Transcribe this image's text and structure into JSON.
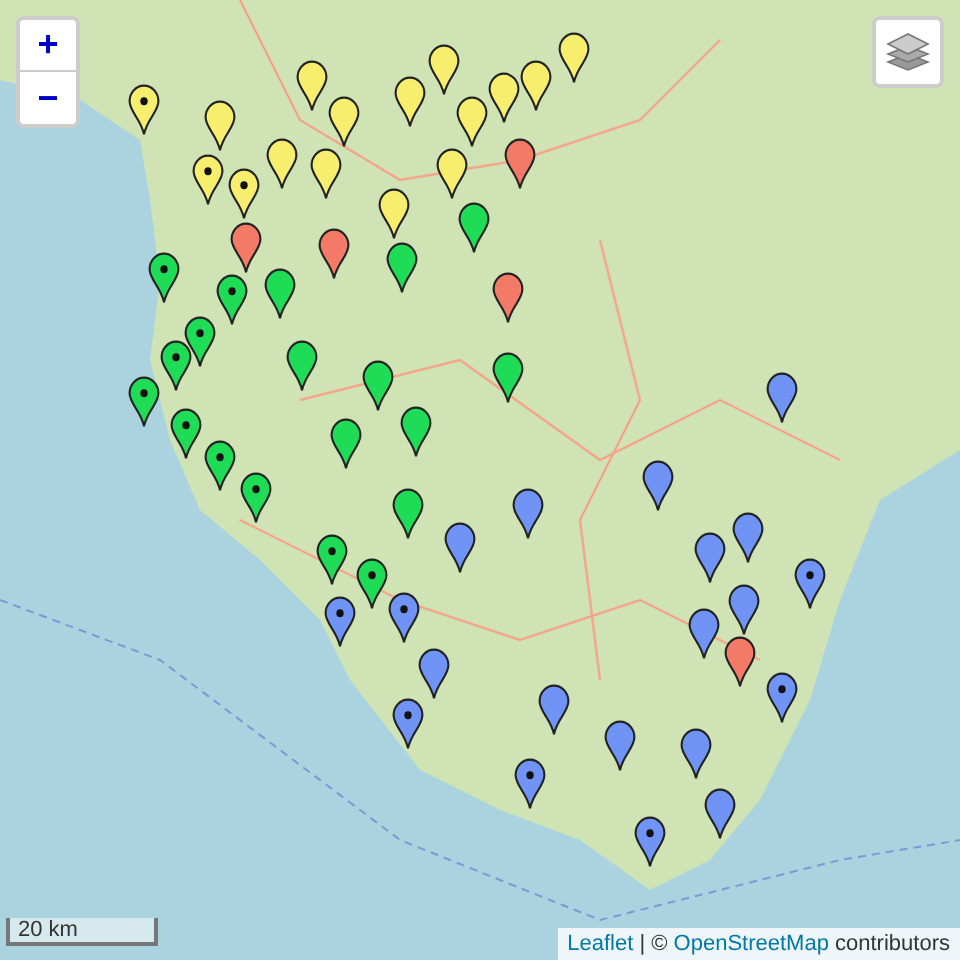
{
  "zoom_controls": {
    "zoom_in": "+",
    "zoom_out": "−"
  },
  "markers": [
    {
      "color": "#f7ee6e",
      "dotted": true
    },
    {
      "color": "#f7ee6e",
      "dotted": false
    },
    {
      "color": "#f7ee6e",
      "dotted": false
    },
    {
      "color": "#f7ee6e",
      "dotted": false
    },
    {
      "color": "#f7ee6e",
      "dotted": false
    },
    {
      "color": "#f7ee6e",
      "dotted": false
    },
    {
      "color": "#f7ee6e",
      "dotted": true
    },
    {
      "color": "#f7ee6e",
      "dotted": true
    },
    {
      "color": "#f7ee6e",
      "dotted": false
    },
    {
      "color": "#f7ee6e",
      "dotted": false
    },
    {
      "color": "#f7ee6e",
      "dotted": false
    },
    {
      "color": "#f7ee6e",
      "dotted": false
    },
    {
      "color": "#f7ee6e",
      "dotted": false
    },
    {
      "color": "#f7ee6e",
      "dotted": false
    },
    {
      "color": "#f7ee6e",
      "dotted": false
    },
    {
      "color": "#f7ee6e",
      "dotted": false
    },
    {
      "color": "#f47a68",
      "dotted": false
    },
    {
      "color": "#f47a68",
      "dotted": false
    },
    {
      "color": "#f47a68",
      "dotted": false
    },
    {
      "color": "#f47a68",
      "dotted": false
    },
    {
      "color": "#1fdc57",
      "dotted": true
    },
    {
      "color": "#1fdc57",
      "dotted": true
    },
    {
      "color": "#1fdc57",
      "dotted": true
    },
    {
      "color": "#1fdc57",
      "dotted": false
    },
    {
      "color": "#1fdc57",
      "dotted": false
    },
    {
      "color": "#1fdc57",
      "dotted": false
    },
    {
      "color": "#1fdc57",
      "dotted": false
    },
    {
      "color": "#1fdc57",
      "dotted": false
    },
    {
      "color": "#1fdc57",
      "dotted": false
    },
    {
      "color": "#1fdc57",
      "dotted": true
    },
    {
      "color": "#1fdc57",
      "dotted": true
    },
    {
      "color": "#1fdc57",
      "dotted": true
    },
    {
      "color": "#1fdc57",
      "dotted": true
    },
    {
      "color": "#1fdc57",
      "dotted": false
    },
    {
      "color": "#1fdc57",
      "dotted": false
    },
    {
      "color": "#1fdc57",
      "dotted": true
    },
    {
      "color": "#1fdc57",
      "dotted": false
    },
    {
      "color": "#1fdc57",
      "dotted": true
    },
    {
      "color": "#1fdc57",
      "dotted": true
    },
    {
      "color": "#6f94f5",
      "dotted": false
    },
    {
      "color": "#6f94f5",
      "dotted": false
    },
    {
      "color": "#6f94f5",
      "dotted": false
    },
    {
      "color": "#6f94f5",
      "dotted": false
    },
    {
      "color": "#6f94f5",
      "dotted": true
    },
    {
      "color": "#6f94f5",
      "dotted": true
    },
    {
      "color": "#6f94f5",
      "dotted": false
    },
    {
      "color": "#6f94f5",
      "dotted": false
    },
    {
      "color": "#6f94f5",
      "dotted": true
    },
    {
      "color": "#6f94f5",
      "dotted": false
    },
    {
      "color": "#6f94f5",
      "dotted": true
    },
    {
      "color": "#6f94f5",
      "dotted": false
    },
    {
      "color": "#6f94f5",
      "dotted": false
    },
    {
      "color": "#6f94f5",
      "dotted": true
    },
    {
      "color": "#6f94f5",
      "dotted": false
    },
    {
      "color": "#6f94f5",
      "dotted": false
    },
    {
      "color": "#6f94f5",
      "dotted": true
    },
    {
      "color": "#6f94f5",
      "dotted": false
    },
    {
      "color": "#6f94f5",
      "dotted": false
    },
    {
      "color": "#6f94f5",
      "dotted": true
    },
    {
      "color": "#f47a68",
      "dotted": false
    }
  ],
  "scale": "20 km",
  "attribution": {
    "leaflet_link": "Leaflet",
    "separator": "| ©",
    "osm_link": "OpenStreetMap",
    "suffix": "contributors"
  }
}
